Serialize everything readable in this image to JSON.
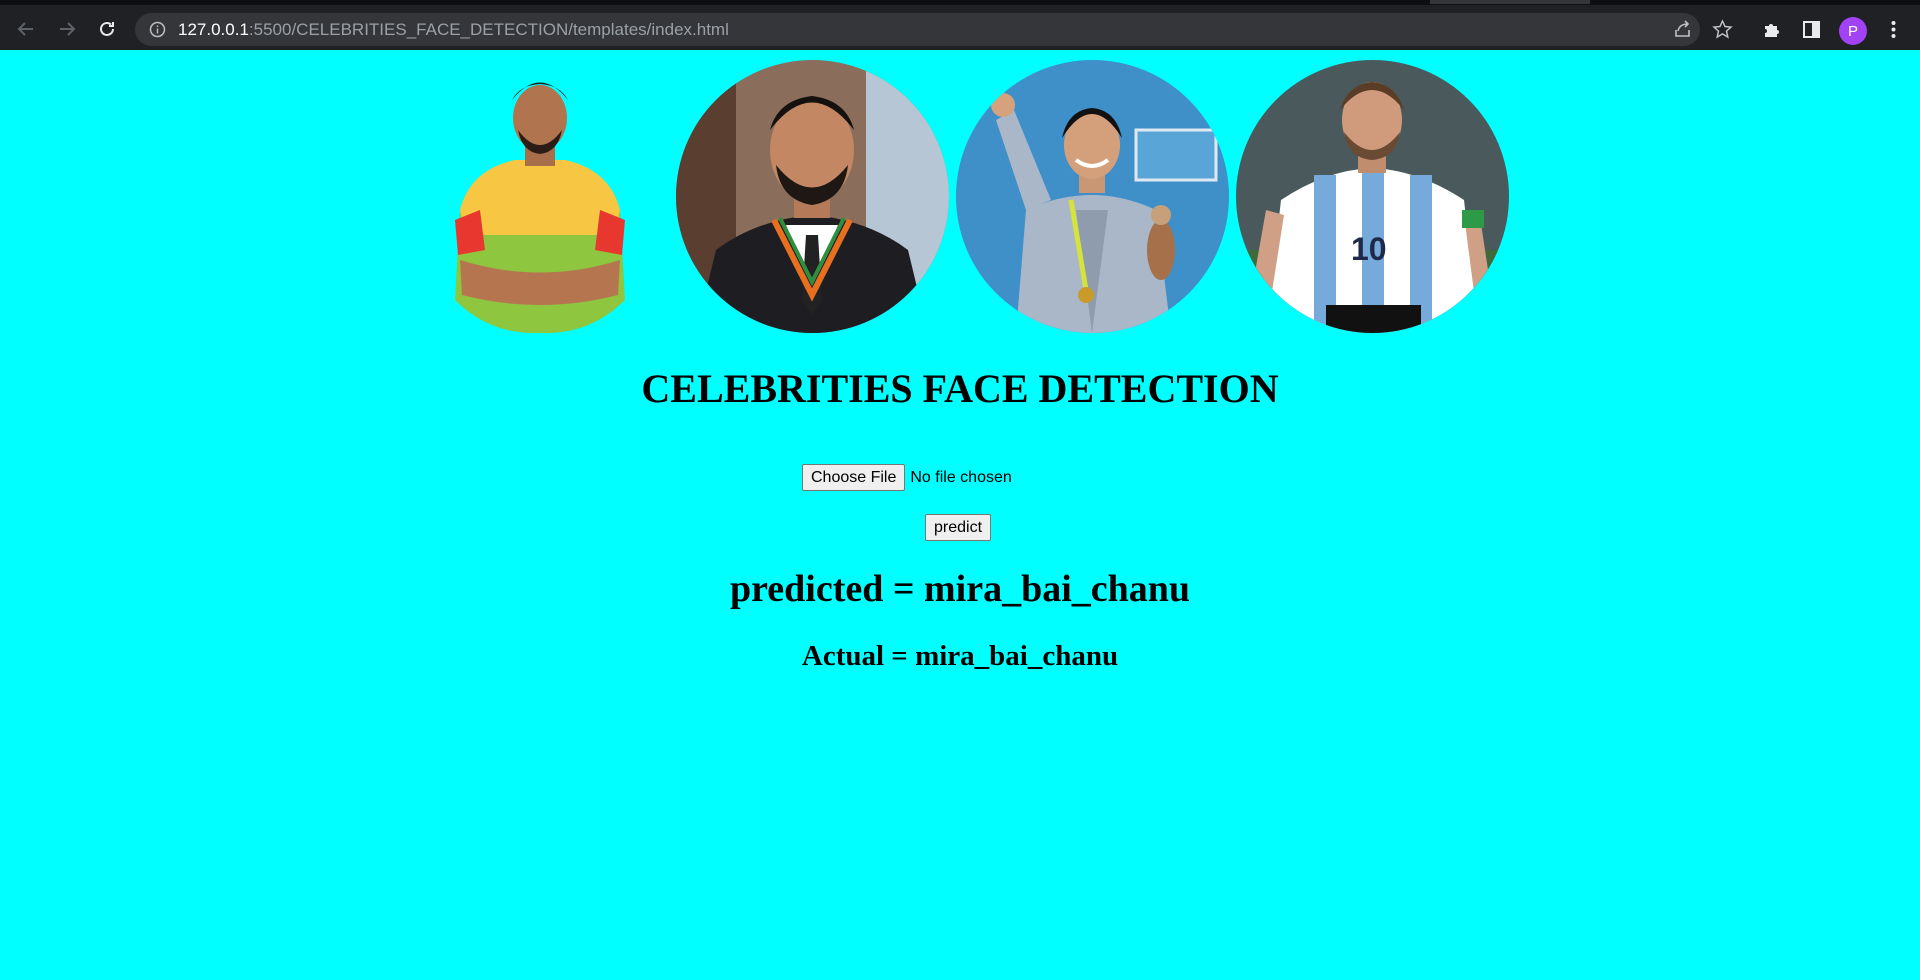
{
  "browser": {
    "url_host": "127.0.0.1",
    "url_path": ":5500/CELEBRITIES_FACE_DETECTION/templates/index.html",
    "profile_initial": "P",
    "profile_color": "#a142f4"
  },
  "page": {
    "background": "#00ffff",
    "title": "CELEBRITIES FACE DETECTION",
    "choose_file_label": "Choose File",
    "file_status": "No file chosen",
    "predict_label": "predict",
    "predicted_text": "predicted = mira_bai_chanu",
    "actual_text": "Actual = mira_bai_chanu"
  },
  "images": [
    {
      "icon": "kabaddi-player-photo"
    },
    {
      "icon": "cricketer-photo"
    },
    {
      "icon": "weightlifter-photo"
    },
    {
      "icon": "footballer-photo"
    }
  ]
}
